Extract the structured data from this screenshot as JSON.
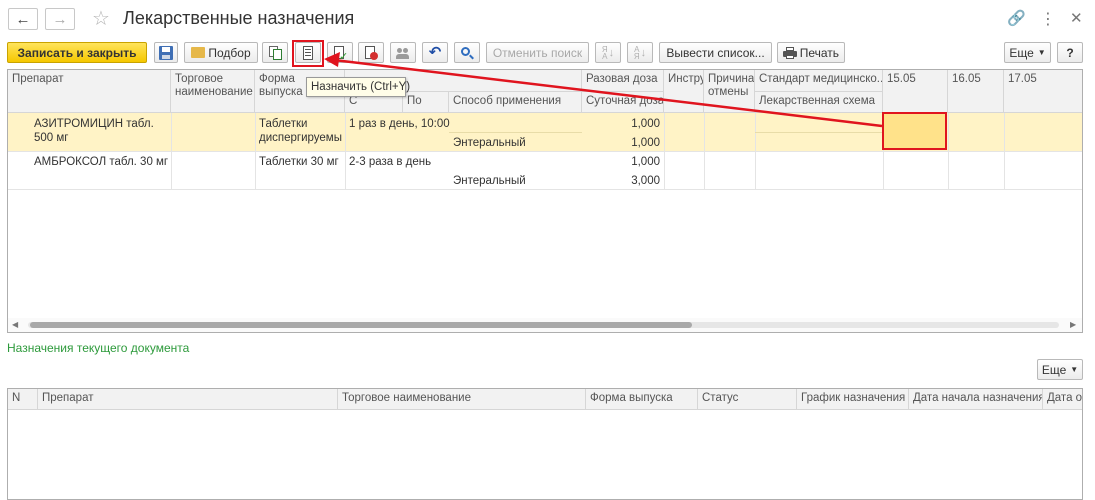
{
  "window": {
    "title": "Лекарственные назначения"
  },
  "toolbar": {
    "save_close": "Записать и закрыть",
    "podbor": "Подбор",
    "cancel_search": "Отменить поиск",
    "output_list": "Вывести список...",
    "print": "Печать",
    "more": "Еще",
    "help": "?"
  },
  "tooltip": "Назначить (Ctrl+Y)",
  "main_table": {
    "headers": {
      "drug": "Препарат",
      "trade_name": "Торговое наименование",
      "form": "Форма выпуска",
      "from": "С",
      "to": "По",
      "method": "Способ применения",
      "single_dose": "Разовая доза",
      "daily_dose": "Суточная доза",
      "instruction": "Инструкция",
      "cancel_reason": "Причина отмены",
      "standard": "Стандарт медицинско...",
      "drug_scheme": "Лекарственная схема",
      "date1": "15.05",
      "date2": "16.05",
      "date3": "17.05"
    },
    "rows": [
      {
        "drug": "АЗИТРОМИЦИН табл. 500 мг",
        "form": "Таблетки диспергируемы",
        "schedule": "1 раз в день, 10:00",
        "method": "Энтеральный",
        "single_dose": "1,000",
        "daily_dose": "1,000"
      },
      {
        "drug": "АМБРОКСОЛ табл. 30 мг",
        "form": "Таблетки 30 мг",
        "schedule": "2-3 раза в день",
        "method": "Энтеральный",
        "single_dose": "1,000",
        "daily_dose": "3,000"
      }
    ]
  },
  "section_title": "Назначения текущего документа",
  "bottom_more": "Еще",
  "bottom_table": {
    "headers": [
      "N",
      "Препарат",
      "Торговое наименование",
      "Форма выпуска",
      "Статус",
      "График назначения",
      "Дата начала назначения",
      "Дата о"
    ]
  },
  "colors": {
    "selected_row": "#fff3c6",
    "highlight_cell": "#ffe28a",
    "annotation": "#e0141e",
    "section_title": "#2d9a3b",
    "primary_button": "#f5c700"
  }
}
